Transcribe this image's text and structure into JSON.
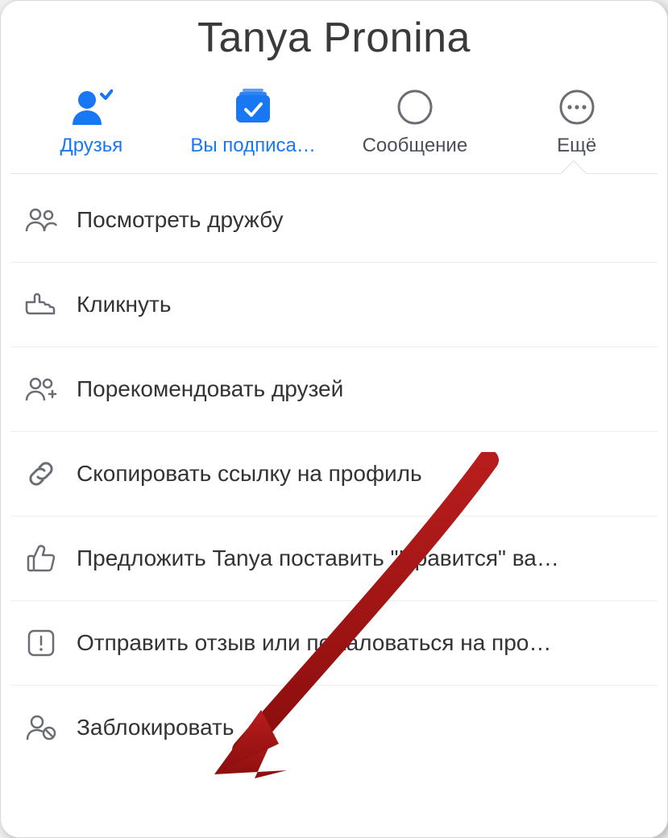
{
  "header": {
    "title": "Tanya Pronina"
  },
  "actions": {
    "friends": {
      "label": "Друзья",
      "accent": true
    },
    "following": {
      "label": "Вы подписа…",
      "accent": true
    },
    "message": {
      "label": "Сообщение",
      "accent": false
    },
    "more": {
      "label": "Ещё",
      "accent": false
    }
  },
  "menu": [
    {
      "id": "see-friendship",
      "icon": "friends-icon",
      "label": "Посмотреть дружбу"
    },
    {
      "id": "click",
      "icon": "pointing-hand-icon",
      "label": "Кликнуть"
    },
    {
      "id": "suggest-friends",
      "icon": "add-friends-icon",
      "label": "Порекомендовать друзей"
    },
    {
      "id": "copy-link",
      "icon": "link-icon",
      "label": "Скопировать ссылку на профиль"
    },
    {
      "id": "suggest-page",
      "icon": "thumbs-up-icon",
      "label": "Предложить Tanya поставить \"Нравится\" ва…"
    },
    {
      "id": "report",
      "icon": "report-icon",
      "label": "Отправить отзыв или пожаловаться на про…"
    },
    {
      "id": "block",
      "icon": "block-user-icon",
      "label": "Заблокировать"
    }
  ],
  "colors": {
    "accent": "#1877f2",
    "iconGray": "#6a6d73",
    "textGray": "#4b4f56",
    "arrow": "#a11010"
  }
}
